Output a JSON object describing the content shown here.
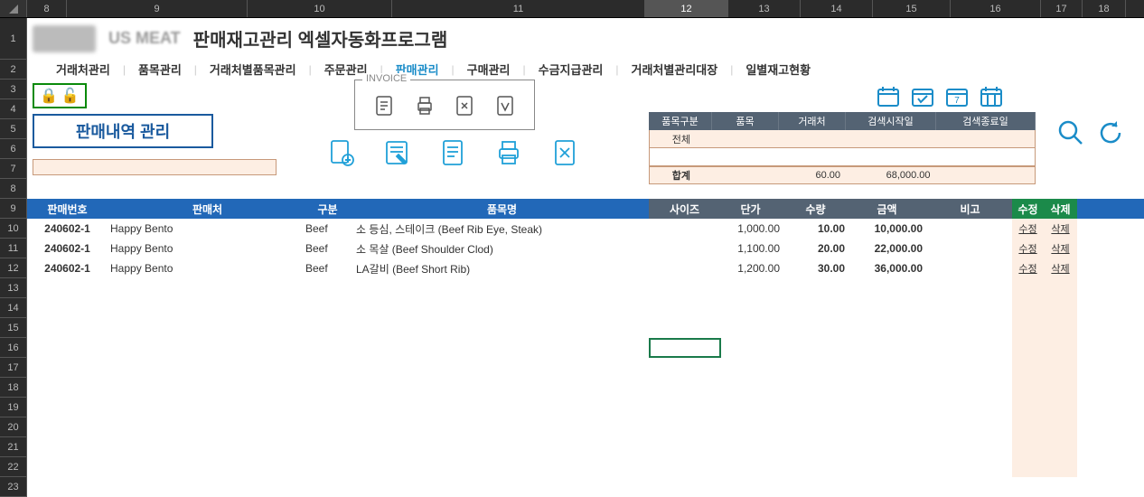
{
  "col_headers": [
    "8",
    "9",
    "10",
    "11",
    "12",
    "13",
    "14",
    "15",
    "16",
    "17",
    "18"
  ],
  "active_col": "12",
  "row_headers": [
    "1",
    "2",
    "3",
    "4",
    "5",
    "6",
    "7",
    "8",
    "9",
    "10",
    "11",
    "12",
    "13",
    "14",
    "15",
    "16",
    "17",
    "18",
    "19",
    "20",
    "21",
    "22",
    "23"
  ],
  "title_prefix": "US MEAT",
  "title": "판매재고관리 엑셀자동화프로그램",
  "nav": [
    {
      "label": "거래처관리"
    },
    {
      "label": "품목관리"
    },
    {
      "label": "거래처별품목관리"
    },
    {
      "label": "주문관리"
    },
    {
      "label": "판매관리",
      "active": true
    },
    {
      "label": "구매관리"
    },
    {
      "label": "수금지급관리"
    },
    {
      "label": "거래처별관리대장"
    },
    {
      "label": "일별재고현황"
    }
  ],
  "sales_title": "판매내역 관리",
  "invoice_label": "INVOICE",
  "filter": {
    "headers": [
      "품목구분",
      "품목",
      "거래처",
      "검색시작일",
      "검색종료일"
    ],
    "kind_value": "전체",
    "sum_label": "합계",
    "sum_qty": "60.00",
    "sum_amt": "68,000.00"
  },
  "table": {
    "headers": {
      "id": "판매번호",
      "vendor": "판매처",
      "cat": "구분",
      "item": "품목명",
      "size": "사이즈",
      "price": "단가",
      "qty": "수량",
      "amt": "금액",
      "note": "비고",
      "edit": "수정",
      "del": "삭제"
    },
    "rows": [
      {
        "id": "240602-1",
        "vendor": "Happy Bento",
        "cat": "Beef",
        "item": "소 등심, 스테이크 (Beef Rib Eye, Steak)",
        "size": "",
        "price": "1,000.00",
        "qty": "10.00",
        "amt": "10,000.00",
        "note": ""
      },
      {
        "id": "240602-1",
        "vendor": "Happy Bento",
        "cat": "Beef",
        "item": "소 목살 (Beef Shoulder Clod)",
        "size": "",
        "price": "1,100.00",
        "qty": "20.00",
        "amt": "22,000.00",
        "note": ""
      },
      {
        "id": "240602-1",
        "vendor": "Happy Bento",
        "cat": "Beef",
        "item": "LA갈비 (Beef Short Rib)",
        "size": "",
        "price": "1,200.00",
        "qty": "30.00",
        "amt": "36,000.00",
        "note": ""
      }
    ],
    "edit_label": "수정",
    "del_label": "삭제"
  }
}
